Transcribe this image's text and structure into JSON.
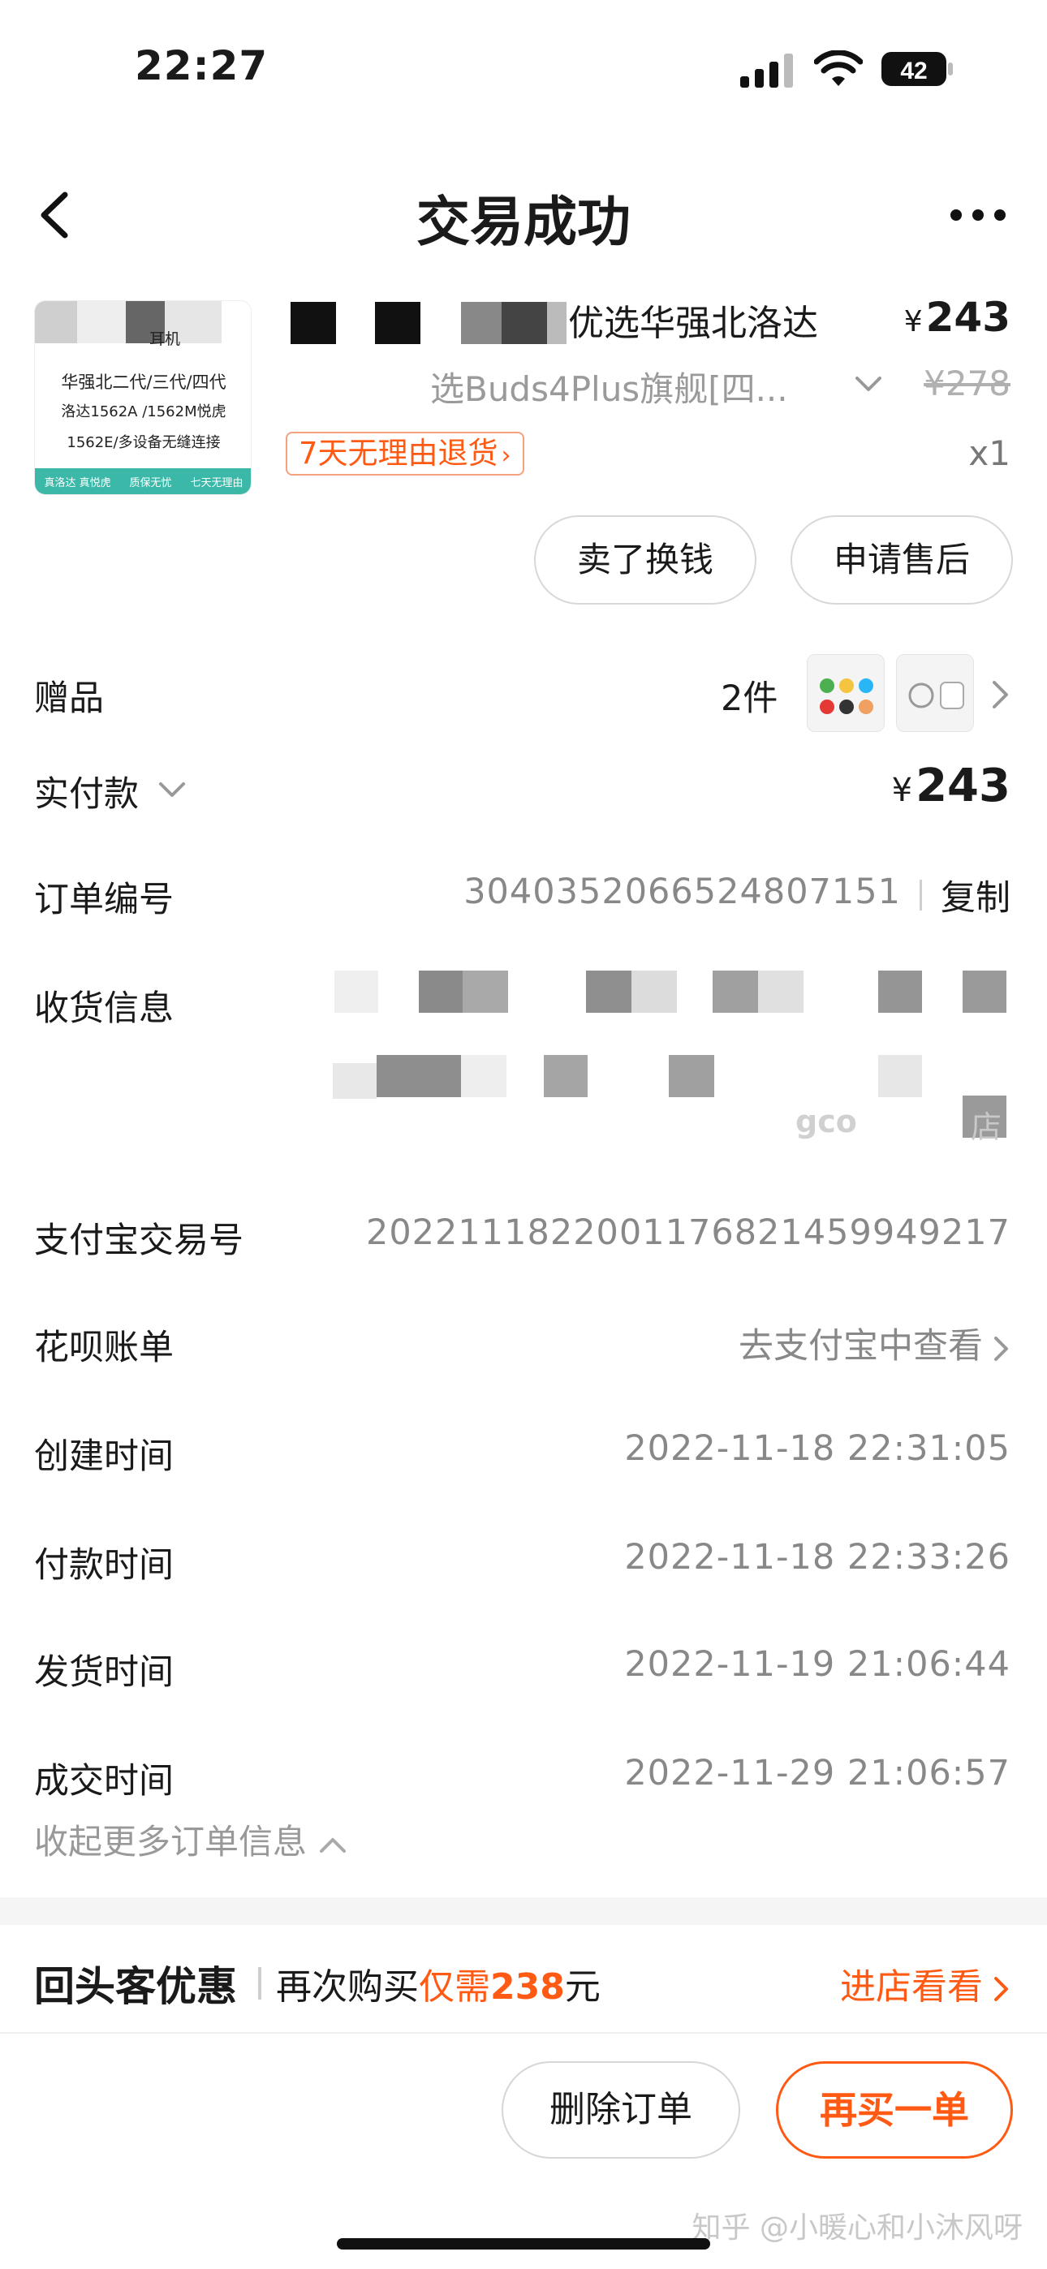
{
  "status_bar": {
    "time": "22:27",
    "battery": "42"
  },
  "header": {
    "title": "交易成功"
  },
  "product": {
    "image_lines": [
      "华强北二代/三代/四代",
      "洛达1562A /1562M悦虎",
      "1562E/多设备无缝连接"
    ],
    "image_top_text": "耳机",
    "image_footer": [
      "真洛达 真悦虎",
      "质保无忧",
      "七天无理由"
    ],
    "title": "优选华强北洛达",
    "price_symbol": "¥",
    "price": "243",
    "sku": "选Buds4Plus旗舰[四...",
    "original_price": "¥278",
    "return_policy": "7天无理由退货",
    "quantity": "x1"
  },
  "actions": {
    "sell": "卖了换钱",
    "aftersale": "申请售后"
  },
  "info": {
    "gift_label": "赠品",
    "gift_count": "2件",
    "paid_label": "实付款",
    "paid_symbol": "¥",
    "paid_amount": "243",
    "order_no_label": "订单编号",
    "order_no": "3040352066524807151",
    "copy": "复制",
    "address_label": "收货信息",
    "address_fragment_1": "gco",
    "address_fragment_2": "店",
    "alipay_label": "支付宝交易号",
    "alipay_no": "2022111822001176821459949217",
    "huabei_label": "花呗账单",
    "huabei_value": "去支付宝中查看",
    "created_label": "创建时间",
    "created_value": "2022-11-18 22:31:05",
    "paid_time_label": "付款时间",
    "paid_time_value": "2022-11-18 22:33:26",
    "shipped_label": "发货时间",
    "shipped_value": "2022-11-19 21:06:44",
    "closed_label": "成交时间",
    "closed_value": "2022-11-29 21:06:57",
    "collapse": "收起更多订单信息"
  },
  "promo": {
    "title": "回头客优惠",
    "text_prefix": "再次购买",
    "text_highlight": "仅需",
    "text_number": "238",
    "text_suffix": "元",
    "link": "进店看看"
  },
  "bottom": {
    "delete": "删除订单",
    "rebuy": "再买一单"
  },
  "watermark": "知乎 @小暖心和小沐风呀",
  "colors": {
    "accent": "#ff5a14",
    "muted": "#888888",
    "border": "#d8d8d8"
  }
}
